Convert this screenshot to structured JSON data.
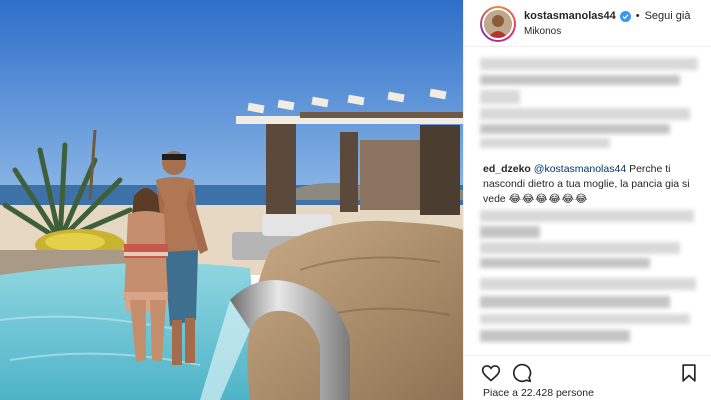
{
  "header": {
    "username": "kostasmanolas44",
    "separator": "•",
    "follow_label": "Segui già",
    "location": "Mikonos"
  },
  "comment": {
    "author": "ed_dzeko",
    "mention": "@kostasmanolas44",
    "text": " Perche ti nascondi dietro a tua moglie, la pancia gia si vede ",
    "emojis": "😂😂😂😂😂😂"
  },
  "actions": {
    "like_icon": "heart-icon",
    "comment_icon": "comment-icon",
    "save_icon": "bookmark-icon"
  },
  "likes": {
    "text": "Piace a 22.428 persone"
  },
  "colors": {
    "accent": "#3897f0",
    "mention": "#003569"
  }
}
